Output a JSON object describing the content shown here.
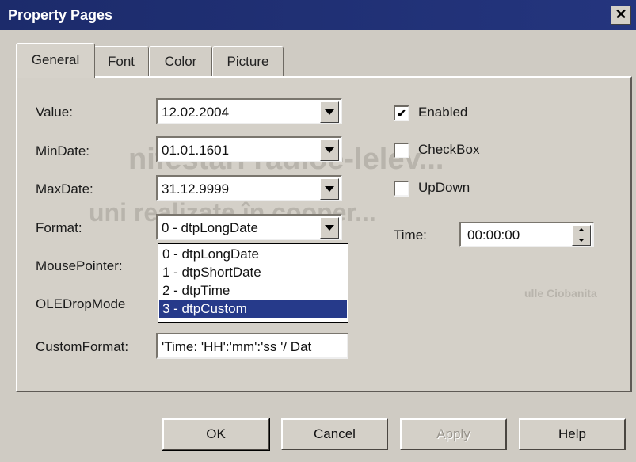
{
  "window": {
    "title": "Property Pages",
    "close_symbol": "✕"
  },
  "tabs": [
    {
      "label": "General",
      "active": true
    },
    {
      "label": "Font",
      "active": false
    },
    {
      "label": "Color",
      "active": false
    },
    {
      "label": "Picture",
      "active": false
    }
  ],
  "fields": {
    "value": {
      "label": "Value:",
      "value": "12.02.2004"
    },
    "mindate": {
      "label": "MinDate:",
      "value": "01.01.1601"
    },
    "maxdate": {
      "label": "MaxDate:",
      "value": "31.12.9999"
    },
    "format": {
      "label": "Format:",
      "value": "0 - dtpLongDate"
    },
    "mousepointer": {
      "label": "MousePointer:"
    },
    "oledropmode": {
      "label": "OLEDropMode"
    },
    "customformat": {
      "label": "CustomFormat:",
      "value": "'Time: 'HH':'mm':'ss '/ Dat"
    }
  },
  "format_options": [
    "0 - dtpLongDate",
    "1 - dtpShortDate",
    "2 - dtpTime",
    "3 - dtpCustom"
  ],
  "format_options_selected": "3 - dtpCustom",
  "checkboxes": {
    "enabled": {
      "label": "Enabled",
      "checked": true,
      "mark": "✔"
    },
    "checkbox": {
      "label": "CheckBox",
      "checked": false
    },
    "updown": {
      "label": "UpDown",
      "checked": false
    }
  },
  "time": {
    "label": "Time:",
    "value": "00:00:00"
  },
  "buttons": {
    "ok": "OK",
    "cancel": "Cancel",
    "apply": "Apply",
    "help": "Help"
  },
  "background_text": {
    "line1": "nifestări radioe-lelev...",
    "line2": "uni realizate în cooper...",
    "line3": "ulle Ciobanita"
  },
  "colors": {
    "title_bar": "#1c2b6b",
    "selection": "#263a8a",
    "dialog_bg": "#d4d0c8"
  }
}
